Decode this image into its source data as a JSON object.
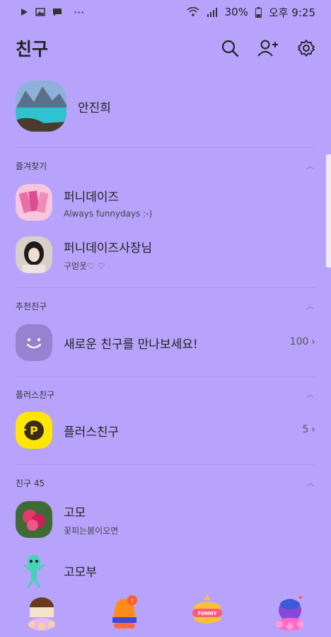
{
  "status_bar": {
    "left_icons": [
      "play-icon",
      "image-icon",
      "message-icon",
      "more-icon"
    ],
    "more": "···",
    "battery": "30%",
    "time": "오후 9:25"
  },
  "header": {
    "title": "친구",
    "icons": [
      "search-icon",
      "add-friend-icon",
      "settings-icon"
    ]
  },
  "my_profile": {
    "name": "안진희"
  },
  "favorites": {
    "label": "즐겨찾기",
    "items": [
      {
        "name": "퍼니데이즈",
        "status": "Always funnydays :-)"
      },
      {
        "name": "퍼니데이즈사장님",
        "status": "구얻옷♡ ♡"
      }
    ]
  },
  "recommended": {
    "label": "추천친구",
    "item": {
      "name": "새로운 친구를 만나보세요!",
      "count": "100"
    }
  },
  "plus": {
    "label": "플러스친구",
    "item": {
      "name": "플러스친구",
      "count": "5"
    }
  },
  "friends": {
    "label": "친구 45",
    "items": [
      {
        "name": "고모",
        "status": "꽃피는봄이오면"
      },
      {
        "name": "고모부",
        "status": ""
      }
    ]
  },
  "tabs": [
    "friends-tab",
    "chats-tab",
    "hash-tab",
    "more-tab"
  ],
  "tab_badge_text": "FUNNY",
  "colors": {
    "background": "#B7A3FB",
    "plus_yellow": "#FFE600"
  }
}
